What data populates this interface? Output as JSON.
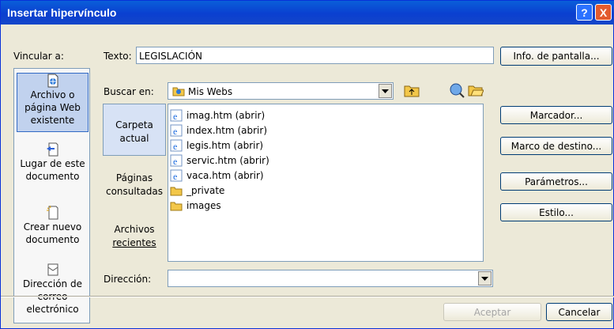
{
  "window": {
    "title": "Insertar hipervínculo",
    "help": "?",
    "close": "X"
  },
  "sidebar": {
    "label": "Vincular a:",
    "items": [
      {
        "line1": "Archivo o",
        "line2": "página Web",
        "line3": "existente",
        "icon": "file-web-icon"
      },
      {
        "line1": "Lugar de este",
        "line2": "documento",
        "icon": "document-place-icon"
      },
      {
        "line1": "Crear nuevo",
        "line2": "documento",
        "icon": "new-document-icon"
      },
      {
        "line1": "Dirección de",
        "line2": "correo",
        "line3": "electrónico",
        "icon": "email-icon"
      }
    ]
  },
  "text_field": {
    "label": "Texto:",
    "value": "LEGISLACIÓN"
  },
  "buttons": {
    "screen_info": "Info. de pantalla...",
    "bookmark": "Marcador...",
    "target_frame": "Marco de destino...",
    "parameters": "Parámetros...",
    "style": "Estilo...",
    "accept": "Aceptar",
    "cancel": "Cancelar"
  },
  "search": {
    "label": "Buscar en:",
    "value": "Mis Webs"
  },
  "places": [
    {
      "line1": "Carpeta",
      "line2": "actual"
    },
    {
      "line1": "Páginas",
      "line2": "consultadas"
    },
    {
      "line1": "Archivos",
      "line2": "recientes"
    }
  ],
  "files": [
    {
      "name": "imag.htm (abrir)",
      "icon": "ie-icon"
    },
    {
      "name": "index.htm (abrir)",
      "icon": "ie-icon"
    },
    {
      "name": "legis.htm (abrir)",
      "icon": "ie-icon"
    },
    {
      "name": "servic.htm (abrir)",
      "icon": "ie-icon"
    },
    {
      "name": "vaca.htm (abrir)",
      "icon": "ie-icon"
    },
    {
      "name": "_private",
      "icon": "folder-icon"
    },
    {
      "name": "images",
      "icon": "folder-icon"
    }
  ],
  "address": {
    "label": "Dirección:",
    "value": ""
  },
  "colors": {
    "title_blue": "#0a3fd0",
    "selection_blue": "#c1d2ee",
    "dialog_bg": "#ece9d8"
  }
}
